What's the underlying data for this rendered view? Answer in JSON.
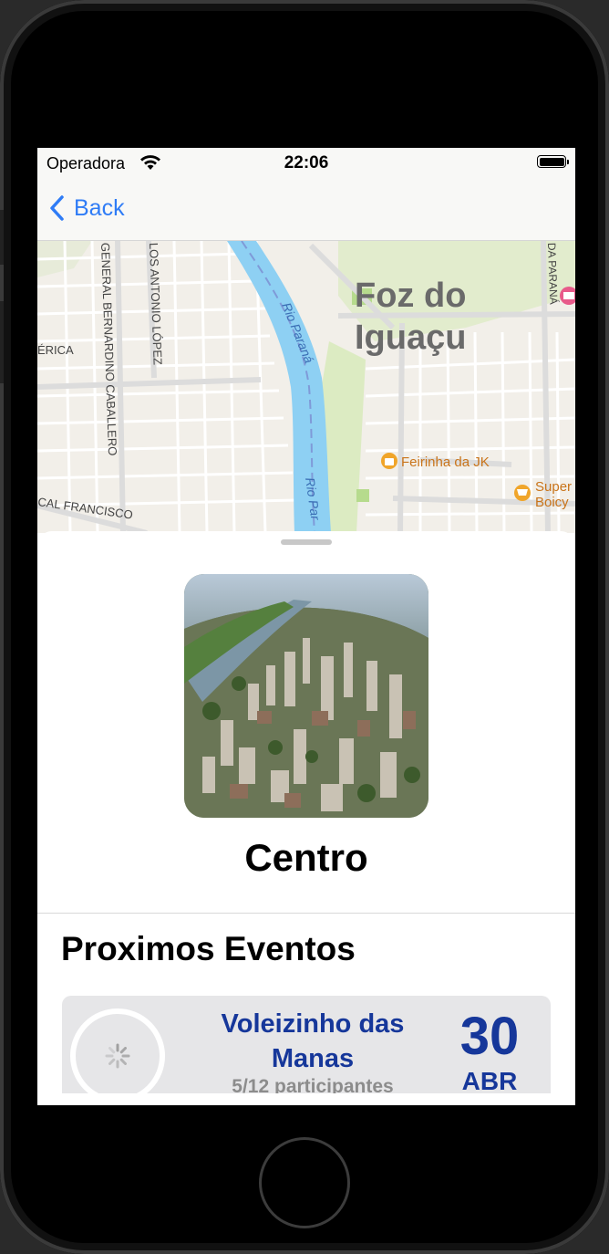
{
  "status_bar": {
    "carrier": "Operadora",
    "time": "22:06"
  },
  "nav": {
    "back_label": "Back"
  },
  "map": {
    "city_line1": "Foz do",
    "city_line2": "Iguaçu",
    "river_label_1": "Rio Paraná",
    "river_label_2": "Rio Par",
    "street_1": "GENERAL BERNARDINO CABALLERO",
    "street_2": "LOS ANTONIO LÓPEZ",
    "street_3": "ÉRICA",
    "street_4": "CAL FRANCISCO",
    "street_5": "DA PARANÁ",
    "poi_1": "Feirinha da JK",
    "poi_2_line1": "Super",
    "poi_2_line2": "Boicy",
    "colors": {
      "water": "#8ed0f3",
      "park": "#d8ecc0",
      "poi": "#f0a52a",
      "poi_pink": "#e85a8a"
    }
  },
  "place": {
    "name": "Centro"
  },
  "events": {
    "section_title": "Proximos Eventos",
    "items": [
      {
        "title": "Voleizinho das Manas",
        "participants": "5/12 participantes",
        "day": "30",
        "month": "ABR"
      }
    ]
  },
  "colors": {
    "accent_blue": "#2f7cf6",
    "event_blue": "#16379a"
  }
}
